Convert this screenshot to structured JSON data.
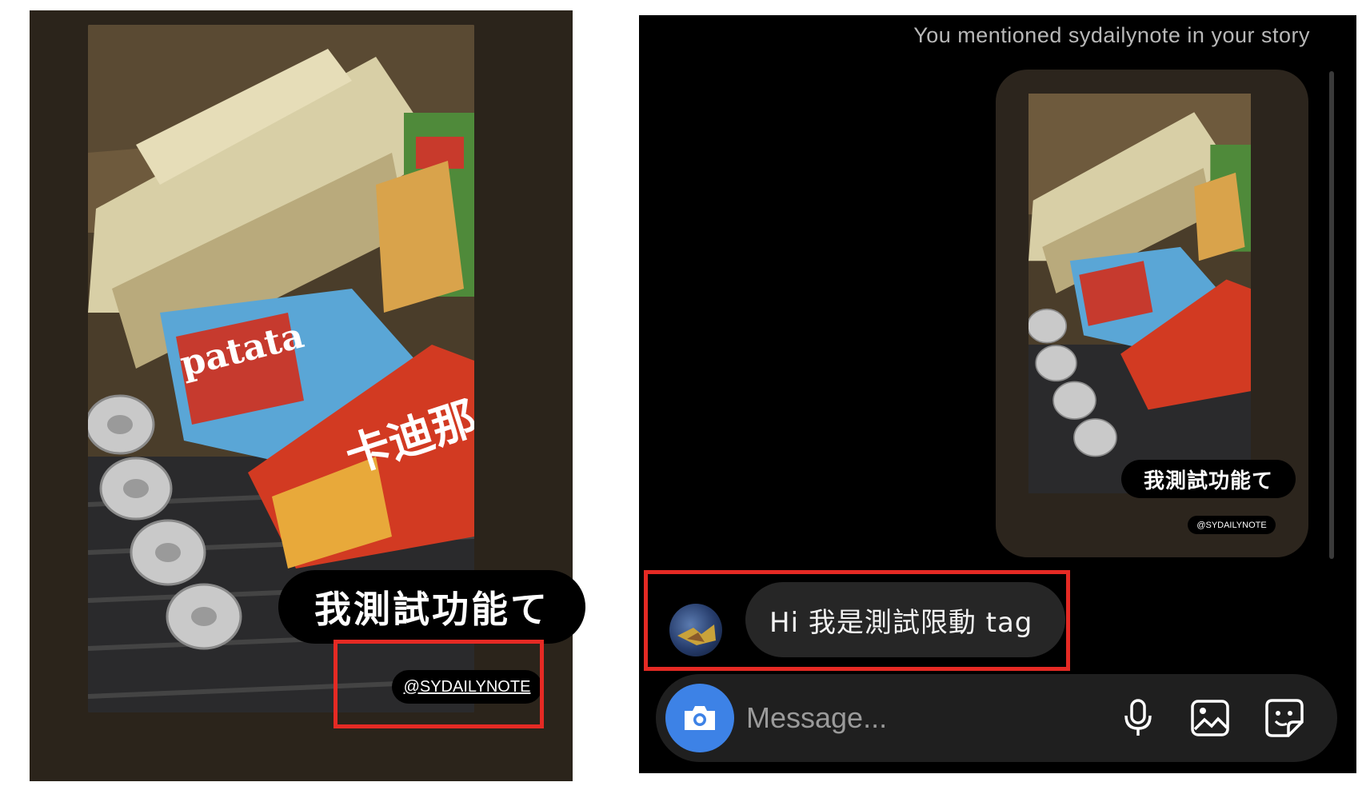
{
  "story": {
    "caption": "我測試功能て",
    "mention_sticker": "@SYDAILYNOTE"
  },
  "dm": {
    "mention_notice": "You mentioned sydailynote in your story",
    "shared_story": {
      "caption": "我測試功能て",
      "mention_sticker": "@SYDAILYNOTE"
    },
    "message": "Hi 我是測試限動 tag",
    "composer": {
      "placeholder": "Message...",
      "icons": [
        "camera-icon",
        "microphone-icon",
        "gallery-icon",
        "sticker-icon"
      ]
    }
  },
  "colors": {
    "highlight": "#e52a24",
    "camera_button": "#3d82e6",
    "dm_background": "#000000",
    "story_background": "#2b241b"
  }
}
